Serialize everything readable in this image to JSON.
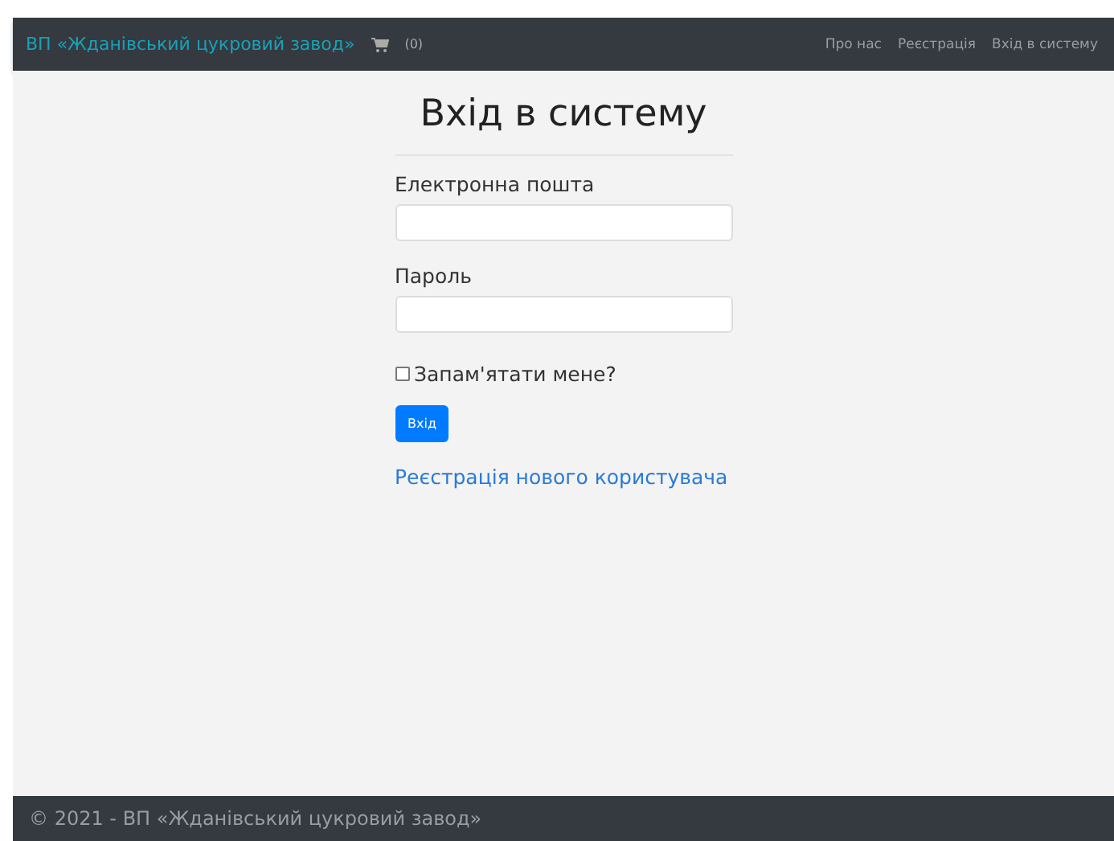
{
  "navbar": {
    "brand": "ВП «Жданівський цукровий завод»",
    "cart_count": "(0)",
    "links": [
      {
        "label": "Про нас"
      },
      {
        "label": "Реєстрація"
      },
      {
        "label": "Вхід в систему"
      }
    ]
  },
  "form": {
    "title": "Вхід в систему",
    "fields": [
      {
        "label": "Електронна пошта"
      },
      {
        "label": "Пароль"
      }
    ],
    "remember": {
      "label": "Запам'ятати мене?",
      "checked": false
    },
    "submit": "Вхід",
    "register_link": "Реєстрація нового користувача"
  },
  "footer": {
    "text": "© 2021 - ВП «Жданівський цукровий завод»"
  }
}
